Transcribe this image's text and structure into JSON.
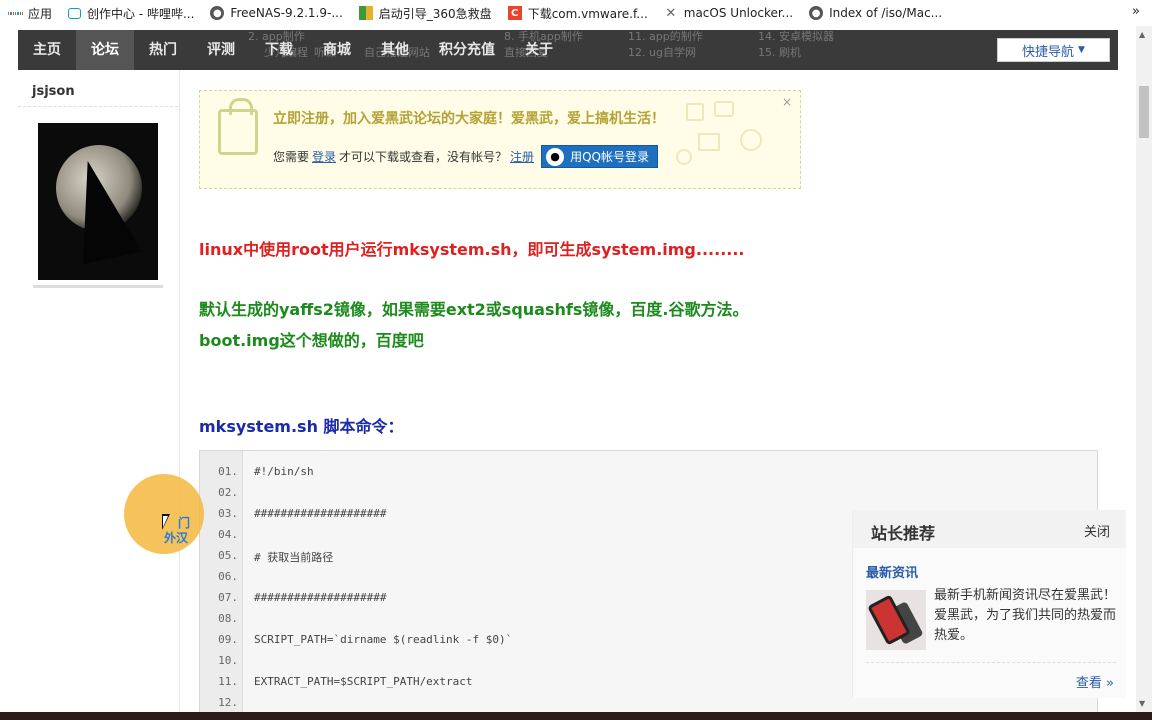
{
  "bookmarks": {
    "items": [
      {
        "label": "应用",
        "icon": "apps-icon"
      },
      {
        "label": "创作中心 - 哔哩哔...",
        "icon": "bilibili-icon"
      },
      {
        "label": "FreeNAS-9.2.1.9-...",
        "icon": "globe-icon"
      },
      {
        "label": "启动引导_360急救盘",
        "icon": "360-icon"
      },
      {
        "label": "下载com.vmware.f...",
        "icon": "csdn-icon"
      },
      {
        "label": "macOS Unlocker...",
        "icon": "x-icon"
      },
      {
        "label": "Index of /iso/Mac...",
        "icon": "globe-icon"
      }
    ],
    "more": "»"
  },
  "nav": {
    "items": [
      "主页",
      "论坛",
      "热门",
      "评测",
      "下载",
      "商城",
      "其他",
      "积分充值",
      "关于"
    ],
    "active_index": 1,
    "quick_nav": "快捷导航",
    "ghost": [
      "2. app制作",
      "少儿编程",
      "听课",
      "自己搭建网站",
      "8. 手机app制作",
      "11. app的制作",
      "14. 安卓模拟器",
      "12. ug自学网",
      "15. 刷机",
      "直接回复"
    ]
  },
  "user": {
    "name": "jsjson"
  },
  "register": {
    "title": "立即注册，加入爱黑武论坛的大家庭！爱黑武，爱上搞机生活！",
    "prefix": "您需要",
    "login": "登录",
    "middle": "才可以下载或查看，没有帐号？",
    "signup": "注册",
    "qq_button": "用QQ帐号登录",
    "close": "×"
  },
  "article": {
    "line1": "linux中使用root用户运行mksystem.sh，即可生成system.img........",
    "line2": "默认生成的yaffs2镜像，如果需要ext2或squashfs镜像，百度.谷歌方法。",
    "line3": "boot.img这个想做的，百度吧",
    "code_heading": "mksystem.sh 脚本命令："
  },
  "code": {
    "lines": [
      {
        "no": "01.",
        "text": "#!/bin/sh"
      },
      {
        "no": "02.",
        "text": ""
      },
      {
        "no": "03.",
        "text": "####################"
      },
      {
        "no": "04.",
        "text": ""
      },
      {
        "no": "05.",
        "text": "# 获取当前路径"
      },
      {
        "no": "06.",
        "text": ""
      },
      {
        "no": "07.",
        "text": "####################"
      },
      {
        "no": "08.",
        "text": ""
      },
      {
        "no": "09.",
        "text": "SCRIPT_PATH=`dirname $(readlink -f $0)`"
      },
      {
        "no": "10.",
        "text": ""
      },
      {
        "no": "11.",
        "text": "EXTRACT_PATH=$SCRIPT_PATH/extract"
      },
      {
        "no": "12.",
        "text": ""
      }
    ]
  },
  "recommend": {
    "title": "站长推荐",
    "close": "关闭",
    "subtitle": "最新资讯",
    "description": "最新手机新闻资讯尽在爱黑武！爱黑武，为了我们共同的热爱而热爱。",
    "more": "查看 »"
  },
  "cursor_overlay": {
    "text1": "门",
    "text2": "外汉"
  },
  "colors": {
    "nav_bg": "#3a3a3a",
    "accent_red": "#e02020",
    "accent_green": "#1d8a1d",
    "accent_blue": "#1a2aa8",
    "link": "#2b5ca8"
  }
}
